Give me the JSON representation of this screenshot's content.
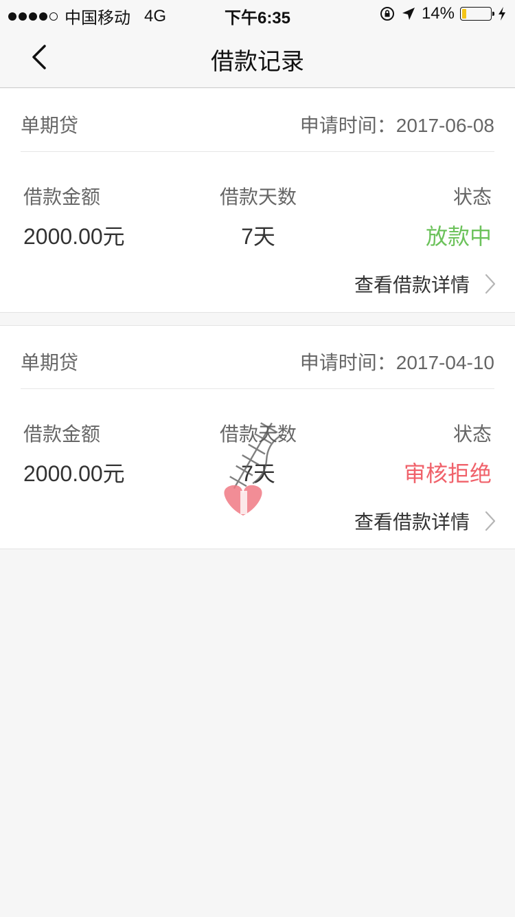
{
  "status_bar": {
    "carrier": "中国移动",
    "network": "4G",
    "time": "下午6:35",
    "battery": "14%",
    "battery_level": 0.14
  },
  "nav": {
    "title": "借款记录",
    "back_icon": "chevron-left-icon"
  },
  "labels": {
    "apply_prefix": "申请时间：",
    "amount": "借款金额",
    "days": "借款天数",
    "status": "状态",
    "detail": "查看借款详情"
  },
  "loans": [
    {
      "product": "单期贷",
      "apply_date": "2017-06-08",
      "amount": "2000.00元",
      "days": "7天",
      "status": "放款中",
      "status_color": "#6cc25b"
    },
    {
      "product": "单期贷",
      "apply_date": "2017-04-10",
      "amount": "2000.00元",
      "days": "7天",
      "status": "审核拒绝",
      "status_color": "#f0616a"
    }
  ]
}
